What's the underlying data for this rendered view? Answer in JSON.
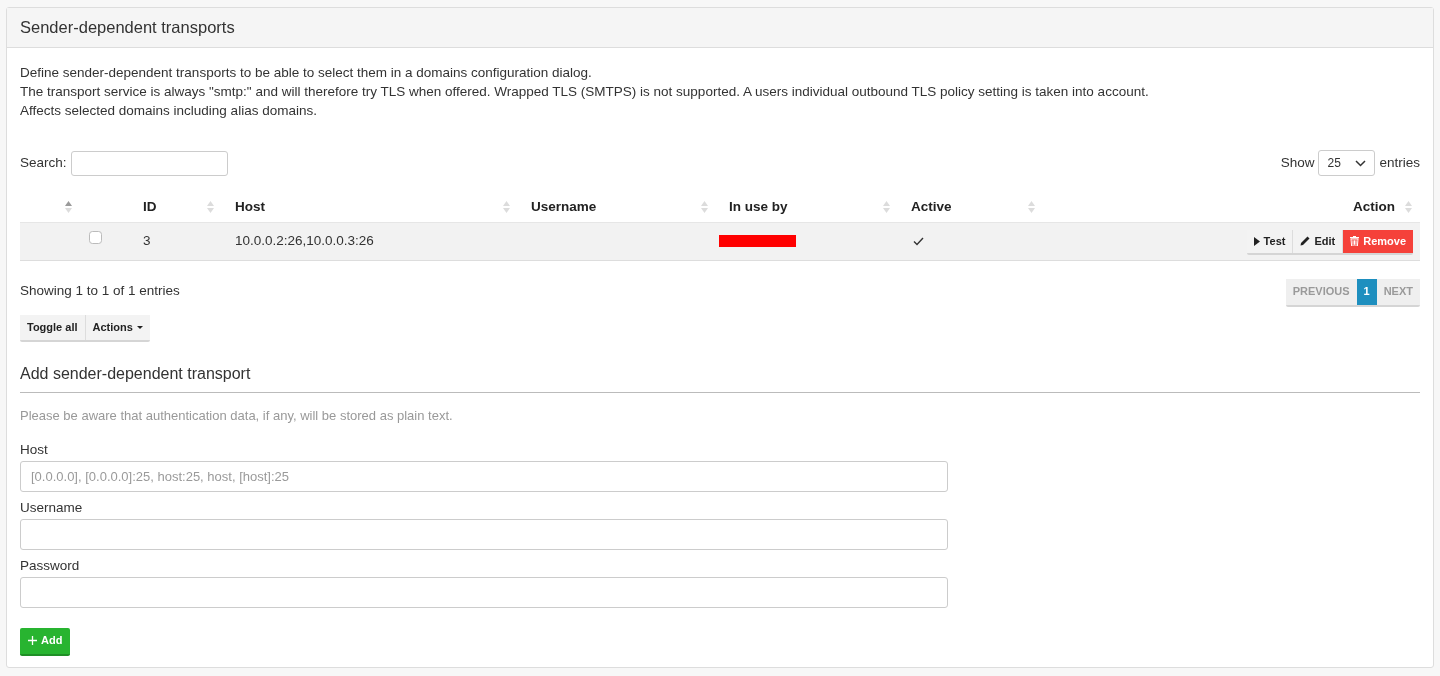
{
  "panel": {
    "title": "Sender-dependent transports",
    "description": [
      "Define sender-dependent transports to be able to select them in a domains configuration dialog.",
      "The transport service is always \"smtp:\" and will therefore try TLS when offered. Wrapped TLS (SMTPS) is not supported. A users individual outbound TLS policy setting is taken into account.",
      "Affects selected domains including alias domains."
    ]
  },
  "search": {
    "label": "Search:"
  },
  "page_length": {
    "label": "Show",
    "value": "25",
    "suffix": "entries"
  },
  "table": {
    "columns": [
      {
        "kind": "control",
        "sorted": true
      },
      {
        "kind": "checkbox"
      },
      {
        "kind": "data",
        "label": "ID",
        "sorted": false
      },
      {
        "kind": "data",
        "label": "Host",
        "sorted": false
      },
      {
        "kind": "data",
        "label": "Username",
        "sorted": false
      },
      {
        "kind": "data",
        "label": "In use by",
        "sorted": false
      },
      {
        "kind": "data",
        "label": "Active",
        "sorted": false
      },
      {
        "kind": "actions",
        "label": "Action",
        "sorted": false
      }
    ],
    "rows": [
      {
        "checked": false,
        "id": "3",
        "host": "10.0.0.2:26,10.0.0.3:26",
        "in_use_by": {
          "redacted": true
        },
        "active": true,
        "actions": [
          {
            "kind": "test",
            "label": "Test"
          },
          {
            "kind": "edit",
            "label": "Edit"
          },
          {
            "kind": "remove",
            "label": "Remove"
          }
        ]
      }
    ]
  },
  "info": "Showing 1 to 1 of 1 entries",
  "pagination": [
    {
      "label": "PREVIOUS",
      "disabled": true,
      "selected": false
    },
    {
      "label": "1",
      "disabled": false,
      "selected": true
    },
    {
      "label": "NEXT",
      "disabled": true,
      "selected": false
    }
  ],
  "bulk_actions": [
    {
      "kind": "toggle",
      "label": "Toggle all"
    },
    {
      "kind": "dropdown",
      "label": "Actions"
    }
  ],
  "add_form": {
    "title": "Add sender-dependent transport",
    "note": "Please be aware that authentication data, if any, will be stored as plain text.",
    "fields": [
      {
        "label": "Host",
        "placeholder": "[0.0.0.0], [0.0.0.0]:25, host:25, host, [host]:25"
      },
      {
        "label": "Username"
      },
      {
        "label": "Password"
      }
    ],
    "submit": {
      "label": "Add"
    }
  }
}
